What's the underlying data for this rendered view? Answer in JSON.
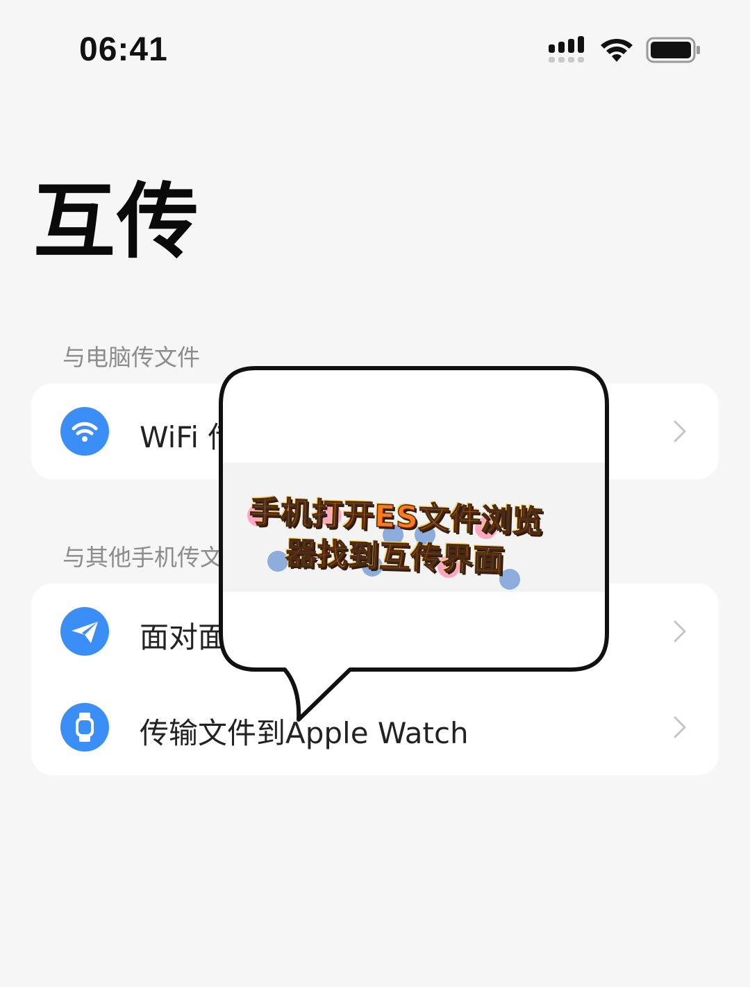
{
  "status_bar": {
    "time": "06:41",
    "signal_icon": "cellular-signal-icon",
    "wifi_icon": "wifi-icon",
    "battery_icon": "battery-icon"
  },
  "page": {
    "title": "互传"
  },
  "sections": [
    {
      "label": "与电脑传文件",
      "items": [
        {
          "label": "WiFi 传",
          "icon": "wifi-circle-icon"
        }
      ]
    },
    {
      "label": "与其他手机传文",
      "items": [
        {
          "label": "面对面传",
          "icon": "paper-plane-icon"
        },
        {
          "label": "传输文件到Apple Watch",
          "icon": "watch-icon"
        }
      ]
    }
  ],
  "overlay": {
    "callout_text": "手机打开ES文件浏览器找到互传界面",
    "text_color": "#ff7a1c",
    "outline_color": "#111111"
  },
  "colors": {
    "accent_blue": "#3a8ef6",
    "background": "#f6f6f6",
    "card": "#ffffff",
    "section_label": "#8c8c8c"
  }
}
